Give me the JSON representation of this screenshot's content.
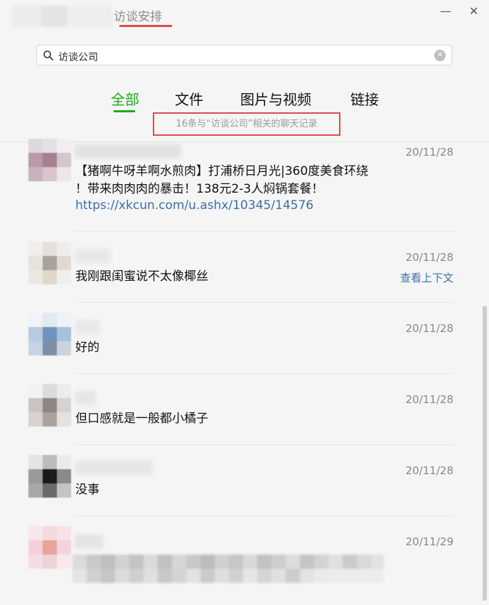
{
  "window": {
    "title": "访谈安排",
    "minimize_glyph": "—",
    "close_glyph": "✕",
    "accent_color": "#1aad19",
    "highlight_color": "#e14a4a",
    "link_color": "#3a6fa8"
  },
  "search": {
    "value": "访谈公司",
    "icon": "search-icon",
    "clear_glyph": "✕"
  },
  "tabs": [
    {
      "label": "全部",
      "active": true
    },
    {
      "label": "文件",
      "active": false
    },
    {
      "label": "图片与视频",
      "active": false
    },
    {
      "label": "链接",
      "active": false
    }
  ],
  "result_count": "16条与“访谈公司”相关的聊天记录",
  "results": [
    {
      "date": "20/11/28",
      "lines": [
        "【猪啊牛呀羊啊水煎肉】打浦桥日月光|360度美食环绕",
        "！带来肉肉肉的暴击！138元2-3人焖锅套餐！"
      ],
      "link": "https://xkcun.com/u.ashx/10345/14576"
    },
    {
      "date": "20/11/28",
      "text": "我刚跟闺蜜说不太像椰丝",
      "context_link": "查看上下文"
    },
    {
      "date": "20/11/28",
      "text": "好的"
    },
    {
      "date": "20/11/28",
      "text": "但口感就是一般都小橘子"
    },
    {
      "date": "20/11/28",
      "text": "没事"
    },
    {
      "date": "20/11/29",
      "text": ""
    }
  ]
}
